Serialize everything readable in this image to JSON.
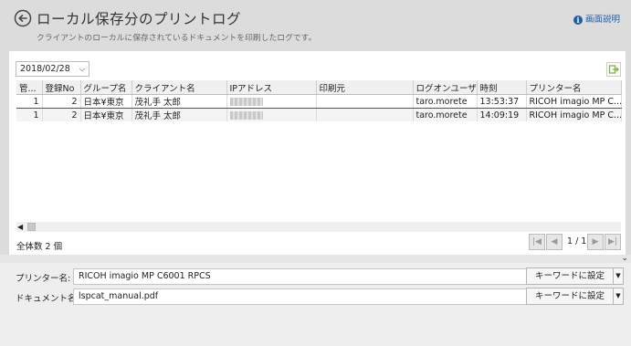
{
  "header": {
    "title": "ローカル保存分のプリントログ",
    "subtitle": "クライアントのローカルに保存されているドキュメントを印刷したログです。",
    "help_label": "画面説明"
  },
  "toolbar": {
    "date_value": "2018/02/28"
  },
  "table": {
    "columns": [
      "管...",
      "登録No",
      "グループ名",
      "クライアント名",
      "IPアドレス",
      "印刷元",
      "ログオンユーザ...",
      "時刻",
      "プリンター名"
    ],
    "rows": [
      {
        "id": "1",
        "reg_no": "2",
        "group": "日本¥東京",
        "client": "茂礼手 太郎",
        "ip": "",
        "source": "",
        "user": "taro.morete",
        "time": "13:53:37",
        "printer": "RICOH imagio MP C..."
      },
      {
        "id": "1",
        "reg_no": "2",
        "group": "日本¥東京",
        "client": "茂礼手 太郎",
        "ip": "",
        "source": "",
        "user": "taro.morete",
        "time": "14:09:19",
        "printer": "RICOH imagio MP C..."
      }
    ]
  },
  "footer": {
    "total_label": "全体数 2 個",
    "page_info": "1 / 1"
  },
  "details": {
    "printer_label": "プリンター名:",
    "printer_value": "RICOH imagio MP C6001 RPCS",
    "document_label": "ドキュメント名:",
    "document_value": "lspcat_manual.pdf",
    "keyword_button": "キーワードに設定"
  },
  "icons": {
    "back": "circle-left-arrow-icon",
    "help": "info-icon",
    "export": "export-icon",
    "dropdown": "chevron-down-icon"
  },
  "colors": {
    "accent": "#1f5fa8",
    "export_icon": "#7cb342"
  }
}
